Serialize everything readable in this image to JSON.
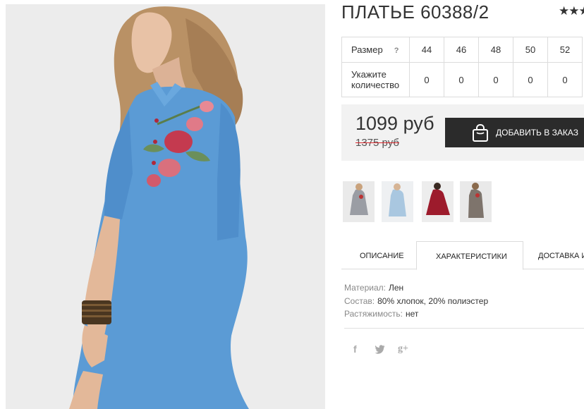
{
  "product": {
    "title": "ПЛАТЬЕ 60388/2",
    "rating_stars": "★★★"
  },
  "sizes_table": {
    "size_label": "Размер",
    "help_icon": "?",
    "qty_label": "Укажите количество",
    "sizes": [
      "44",
      "46",
      "48",
      "50",
      "52"
    ],
    "quantities": [
      "0",
      "0",
      "0",
      "0",
      "0"
    ]
  },
  "buy": {
    "price": "1099 руб",
    "old_price": "1375 руб",
    "add_button": "ДОБАВИТЬ В ЗАКАЗ",
    "icon": "shopping-bag-icon"
  },
  "colors": {
    "dress_main": "#5b9bd5",
    "dark_button": "#2b2b2b",
    "old_price_strike": "#d9262b",
    "buybox_bg": "#f2f2f2"
  },
  "thumbnails": [
    {
      "name": "gray-dress",
      "color": "#9a9da4"
    },
    {
      "name": "light-blue-dress",
      "color": "#a9c7e0"
    },
    {
      "name": "burgundy-dress",
      "color": "#9d1b2c"
    },
    {
      "name": "brown-dress",
      "color": "#7e746c"
    }
  ],
  "tabs": [
    {
      "label": "ОПИСАНИЕ",
      "active": false
    },
    {
      "label": "ХАРАКТЕРИСТИКИ",
      "active": true
    },
    {
      "label": "ДОСТАВКА И",
      "active": false
    }
  ],
  "specs": [
    {
      "name": "Материал:",
      "value": "Лен"
    },
    {
      "name": "Состав:",
      "value": "80% хлопок, 20% полиэстер"
    },
    {
      "name": "Растяжимость:",
      "value": "нет"
    }
  ],
  "social": [
    {
      "icon": "facebook-icon",
      "glyph": "f"
    },
    {
      "icon": "twitter-icon",
      "glyph": "t"
    },
    {
      "icon": "google-plus-icon",
      "glyph": "g+"
    }
  ]
}
